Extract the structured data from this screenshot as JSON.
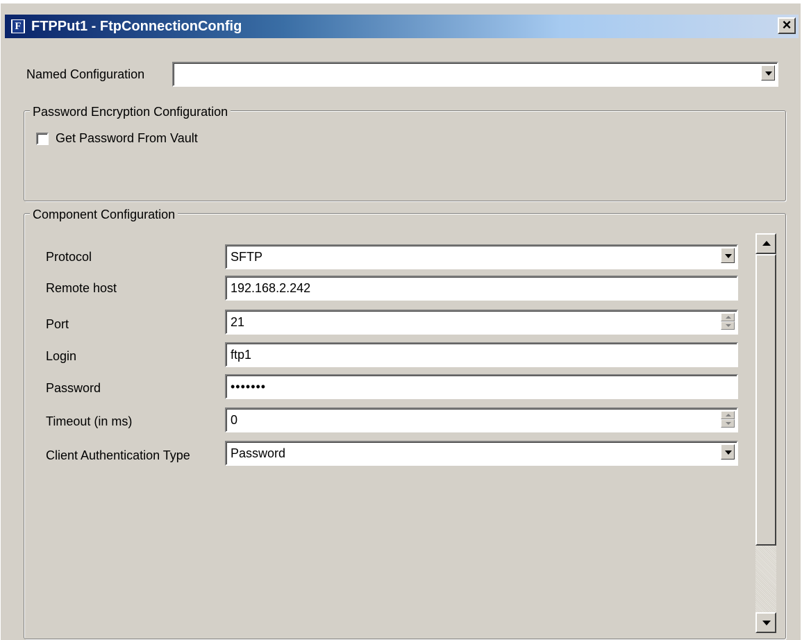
{
  "window": {
    "title": "FTPPut1 - FtpConnectionConfig",
    "icon_letter": "F",
    "close_label": "×"
  },
  "named_configuration": {
    "label": "Named Configuration",
    "value": ""
  },
  "password_encryption": {
    "legend": "Password Encryption Configuration",
    "get_password_from_vault": {
      "label": "Get Password From Vault",
      "checked": false
    }
  },
  "component_configuration": {
    "legend": "Component Configuration",
    "protocol": {
      "label": "Protocol",
      "value": "SFTP"
    },
    "remote_host": {
      "label": "Remote host",
      "value": "192.168.2.242"
    },
    "port": {
      "label": "Port",
      "value": "21"
    },
    "login": {
      "label": "Login",
      "value": "ftp1"
    },
    "password": {
      "label": "Password",
      "value": "•••••••"
    },
    "timeout": {
      "label": "Timeout (in ms)",
      "value": "0"
    },
    "client_auth_type": {
      "label": "Client Authentication Type",
      "value": "Password"
    }
  },
  "icons": {
    "dropdown": "chevron-down-icon",
    "spinner": "spinner-arrows-icon",
    "scroll_up": "arrow-up-icon",
    "scroll_down": "arrow-down-icon"
  }
}
